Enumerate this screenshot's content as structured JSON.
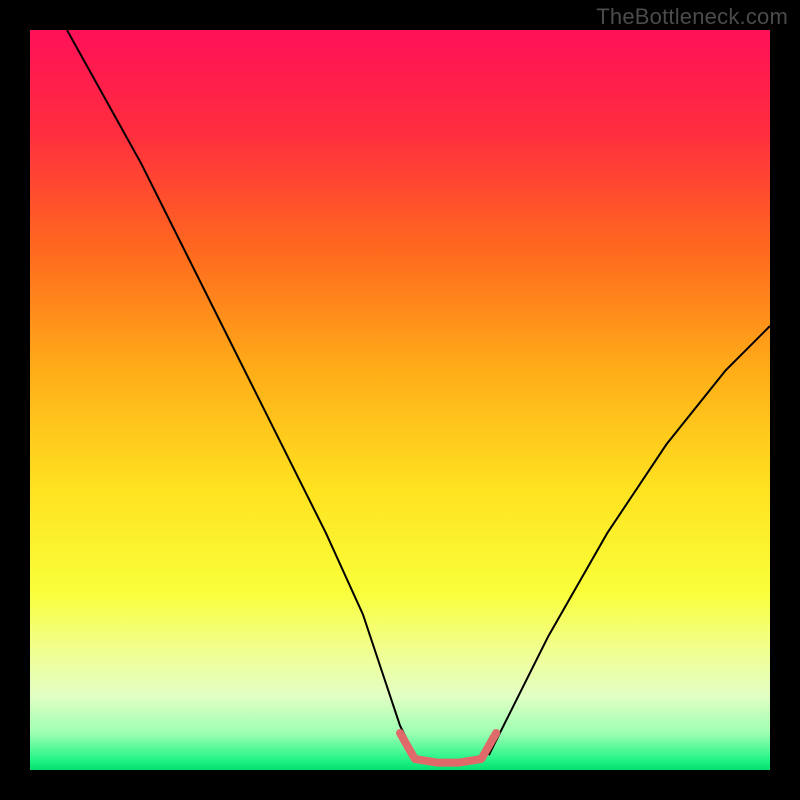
{
  "watermark": "TheBottleneck.com",
  "chart_data": {
    "type": "line",
    "title": "",
    "xlabel": "",
    "ylabel": "",
    "xlim": [
      0,
      100
    ],
    "ylim": [
      0,
      100
    ],
    "grid": false,
    "annotations": [],
    "background_gradient": [
      {
        "stop": 0.0,
        "color": "#ff1058"
      },
      {
        "stop": 0.14,
        "color": "#ff2e3e"
      },
      {
        "stop": 0.3,
        "color": "#ff6a1e"
      },
      {
        "stop": 0.46,
        "color": "#ffad18"
      },
      {
        "stop": 0.62,
        "color": "#ffe220"
      },
      {
        "stop": 0.76,
        "color": "#f9ff3a"
      },
      {
        "stop": 0.84,
        "color": "#f1ff92"
      },
      {
        "stop": 0.9,
        "color": "#e2ffc5"
      },
      {
        "stop": 0.95,
        "color": "#9dffb2"
      },
      {
        "stop": 0.985,
        "color": "#28f588"
      },
      {
        "stop": 1.0,
        "color": "#00e070"
      }
    ],
    "series": [
      {
        "name": "left-branch",
        "stroke": "#000000",
        "stroke_width": 2,
        "x": [
          5,
          10,
          15,
          20,
          25,
          30,
          35,
          40,
          45,
          48,
          50,
          52
        ],
        "y": [
          100,
          91,
          82,
          72,
          62,
          52,
          42,
          32,
          21,
          12,
          6,
          2
        ]
      },
      {
        "name": "right-branch",
        "stroke": "#000000",
        "stroke_width": 2,
        "x": [
          62,
          64,
          67,
          70,
          74,
          78,
          82,
          86,
          90,
          94,
          98,
          100
        ],
        "y": [
          2,
          6,
          12,
          18,
          25,
          32,
          38,
          44,
          49,
          54,
          58,
          60
        ]
      },
      {
        "name": "valley-floor",
        "stroke": "#e06a6a",
        "stroke_width": 8,
        "linecap": "round",
        "x": [
          50,
          52,
          55,
          58,
          61,
          63
        ],
        "y": [
          5,
          1.5,
          1,
          1,
          1.5,
          5
        ]
      }
    ]
  }
}
